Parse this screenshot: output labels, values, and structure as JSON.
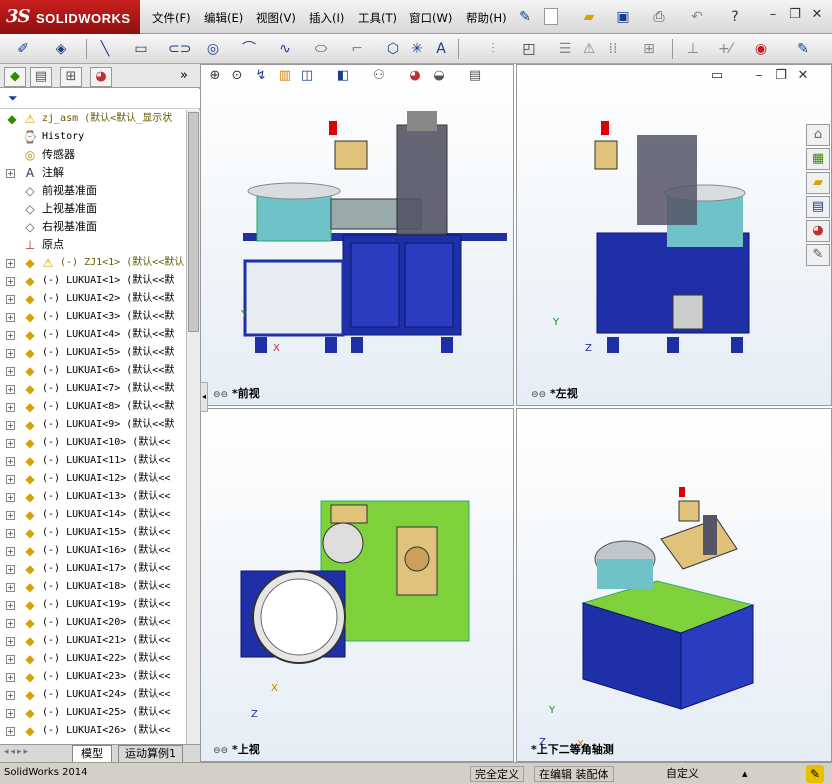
{
  "app": {
    "brand_ds": "3S",
    "brand_name": "SOLIDWORKS"
  },
  "menu": [
    "文件(F)",
    "编辑(E)",
    "视图(V)",
    "插入(I)",
    "工具(T)",
    "窗口(W)",
    "帮助(H)"
  ],
  "panel": {
    "tree": [
      {
        "label": "zj_asm  (默认<默认_显示状",
        "type": "root"
      },
      {
        "label": "History",
        "type": "history"
      },
      {
        "label": "传感器",
        "type": "sensor"
      },
      {
        "label": "注解",
        "type": "annotation"
      },
      {
        "label": "前视基准面",
        "type": "plane"
      },
      {
        "label": "上视基准面",
        "type": "plane"
      },
      {
        "label": "右视基准面",
        "type": "plane"
      },
      {
        "label": "原点",
        "type": "origin"
      },
      {
        "label": "(-) ZJ1<1> (默认<<默认",
        "type": "warn"
      },
      {
        "label": "(-) LUKUAI<1> (默认<<默",
        "type": "part"
      },
      {
        "label": "(-) LUKUAI<2> (默认<<默",
        "type": "part"
      },
      {
        "label": "(-) LUKUAI<3> (默认<<默",
        "type": "part"
      },
      {
        "label": "(-) LUKUAI<4> (默认<<默",
        "type": "part"
      },
      {
        "label": "(-) LUKUAI<5> (默认<<默",
        "type": "part"
      },
      {
        "label": "(-) LUKUAI<6> (默认<<默",
        "type": "part"
      },
      {
        "label": "(-) LUKUAI<7> (默认<<默",
        "type": "part"
      },
      {
        "label": "(-) LUKUAI<8> (默认<<默",
        "type": "part"
      },
      {
        "label": "(-) LUKUAI<9> (默认<<默",
        "type": "part"
      },
      {
        "label": "(-) LUKUAI<10> (默认<<",
        "type": "part"
      },
      {
        "label": "(-) LUKUAI<11> (默认<<",
        "type": "part"
      },
      {
        "label": "(-) LUKUAI<12> (默认<<",
        "type": "part"
      },
      {
        "label": "(-) LUKUAI<13> (默认<<",
        "type": "part"
      },
      {
        "label": "(-) LUKUAI<14> (默认<<",
        "type": "part"
      },
      {
        "label": "(-) LUKUAI<15> (默认<<",
        "type": "part"
      },
      {
        "label": "(-) LUKUAI<16> (默认<<",
        "type": "part"
      },
      {
        "label": "(-) LUKUAI<17> (默认<<",
        "type": "part"
      },
      {
        "label": "(-) LUKUAI<18> (默认<<",
        "type": "part"
      },
      {
        "label": "(-) LUKUAI<19> (默认<<",
        "type": "part"
      },
      {
        "label": "(-) LUKUAI<20> (默认<<",
        "type": "part"
      },
      {
        "label": "(-) LUKUAI<21> (默认<<",
        "type": "part"
      },
      {
        "label": "(-) LUKUAI<22> (默认<<",
        "type": "part"
      },
      {
        "label": "(-) LUKUAI<23> (默认<<",
        "type": "part"
      },
      {
        "label": "(-) LUKUAI<24> (默认<<",
        "type": "part"
      },
      {
        "label": "(-) LUKUAI<25> (默认<<",
        "type": "part"
      },
      {
        "label": "(-) LUKUAI<26> (默认<<",
        "type": "part"
      }
    ],
    "bottom_tabs": [
      "模型",
      "运动算例1"
    ]
  },
  "viewports": {
    "front": "*前视",
    "left": "*左视",
    "top": "*上视",
    "iso": "*上下二等角轴测"
  },
  "axes": {
    "x": "X",
    "y": "Y",
    "z": "Z"
  },
  "status": {
    "app": "SolidWorks 2014",
    "fully_defined": "完全定义",
    "editing": "在编辑 装配体",
    "custom": "自定义"
  },
  "colors": {
    "brand_red": "#b81a18",
    "machine_blue": "#1f2fa8",
    "plate_green": "#7fd13b",
    "bowl_teal": "#6fc3c8"
  }
}
